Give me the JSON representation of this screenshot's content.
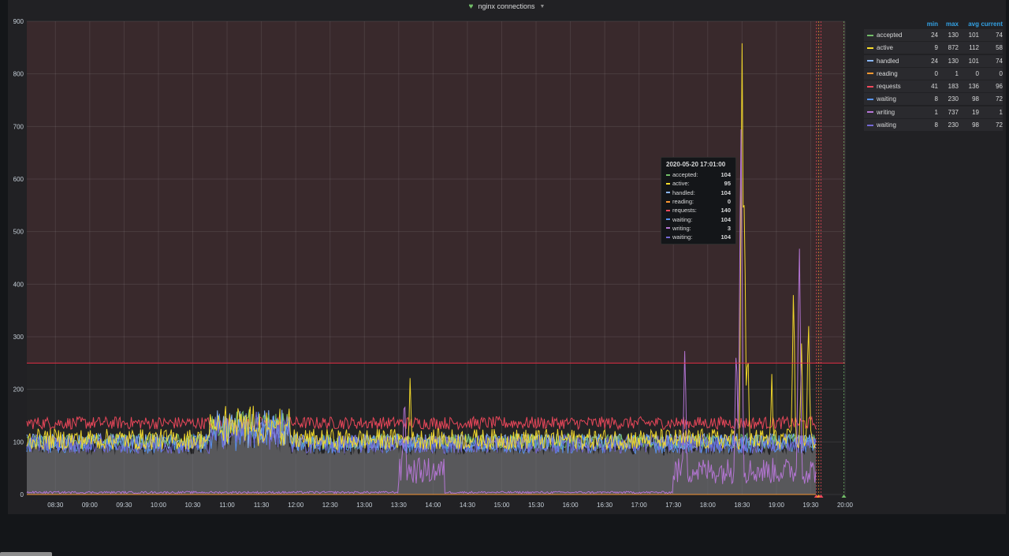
{
  "panel": {
    "title": "nginx connections"
  },
  "chart_data": {
    "type": "line",
    "title": "nginx connections",
    "ylim": [
      0,
      900
    ],
    "y_ticks": [
      0,
      100,
      200,
      300,
      400,
      500,
      600,
      700,
      800,
      900
    ],
    "x_ticks": [
      "08:30",
      "09:00",
      "09:30",
      "10:00",
      "10:30",
      "11:00",
      "11:30",
      "12:00",
      "12:30",
      "13:00",
      "13:30",
      "14:00",
      "14:30",
      "15:00",
      "15:30",
      "16:00",
      "16:30",
      "17:00",
      "17:30",
      "18:00",
      "18:30",
      "19:00",
      "19:30",
      "20:00"
    ],
    "x_start": "08:05",
    "x_end": "20:00",
    "threshold": 250,
    "threshold_color": "#e02f44",
    "grid": true,
    "legend_position": "right",
    "series": [
      {
        "name": "accepted",
        "color": "#73bf69",
        "base": 101,
        "noise": 15,
        "min": 24,
        "max": 130,
        "avg": 101,
        "current": 74
      },
      {
        "name": "active",
        "color": "#fade2a",
        "base": 105,
        "noise": 20,
        "min": 9,
        "max": 872,
        "avg": 112,
        "current": 58
      },
      {
        "name": "handled",
        "color": "#8ab8ff",
        "base": 101,
        "noise": 15,
        "min": 24,
        "max": 130,
        "avg": 101,
        "current": 74
      },
      {
        "name": "reading",
        "color": "#ff9830",
        "base": 0,
        "noise": 0,
        "min": 0,
        "max": 1,
        "avg": 0,
        "current": 0
      },
      {
        "name": "requests",
        "color": "#f2495c",
        "base": 136,
        "noise": 12,
        "min": 41,
        "max": 183,
        "avg": 136,
        "current": 96
      },
      {
        "name": "waiting",
        "color": "#5794f2",
        "base": 96,
        "noise": 18,
        "min": 8,
        "max": 230,
        "avg": 98,
        "current": 72
      },
      {
        "name": "writing",
        "color": "#b877d9",
        "base": 5,
        "noise": 4,
        "min": 1,
        "max": 737,
        "avg": 19,
        "current": 1
      },
      {
        "name": "waiting",
        "color": "#7569d6",
        "base": 96,
        "noise": 18,
        "min": 8,
        "max": 230,
        "avg": 98,
        "current": 72
      }
    ],
    "spikes": [
      {
        "series": "writing",
        "time": "13:35",
        "value": 200
      },
      {
        "series": "active",
        "time": "13:40",
        "value": 230
      },
      {
        "series": "writing",
        "time": "17:40",
        "value": 285
      },
      {
        "series": "writing",
        "time": "18:25",
        "value": 300
      },
      {
        "series": "writing",
        "time": "18:29",
        "value": 737
      },
      {
        "series": "active",
        "time": "18:30",
        "value": 872
      },
      {
        "series": "active",
        "time": "18:32",
        "value": 590
      },
      {
        "series": "active",
        "time": "18:35",
        "value": 300
      },
      {
        "series": "active",
        "time": "18:56",
        "value": 230
      },
      {
        "series": "active",
        "time": "19:15",
        "value": 410
      },
      {
        "series": "writing",
        "time": "19:20",
        "value": 505
      },
      {
        "series": "active",
        "time": "19:22",
        "value": 290
      },
      {
        "series": "active",
        "time": "19:28",
        "value": 355
      }
    ]
  },
  "legend": {
    "headers": [
      "min",
      "max",
      "avg",
      "current"
    ]
  },
  "tooltip": {
    "time": "2020-05-20 17:01:00",
    "rows": [
      {
        "name": "accepted:",
        "value": "104",
        "color": "#73bf69"
      },
      {
        "name": "active:",
        "value": "95",
        "color": "#fade2a"
      },
      {
        "name": "handled:",
        "value": "104",
        "color": "#8ab8ff"
      },
      {
        "name": "reading:",
        "value": "0",
        "color": "#ff9830"
      },
      {
        "name": "requests:",
        "value": "140",
        "color": "#f2495c"
      },
      {
        "name": "waiting:",
        "value": "104",
        "color": "#5794f2"
      },
      {
        "name": "writing:",
        "value": "3",
        "color": "#b877d9"
      },
      {
        "name": "waiting:",
        "value": "104",
        "color": "#7569d6"
      }
    ]
  }
}
